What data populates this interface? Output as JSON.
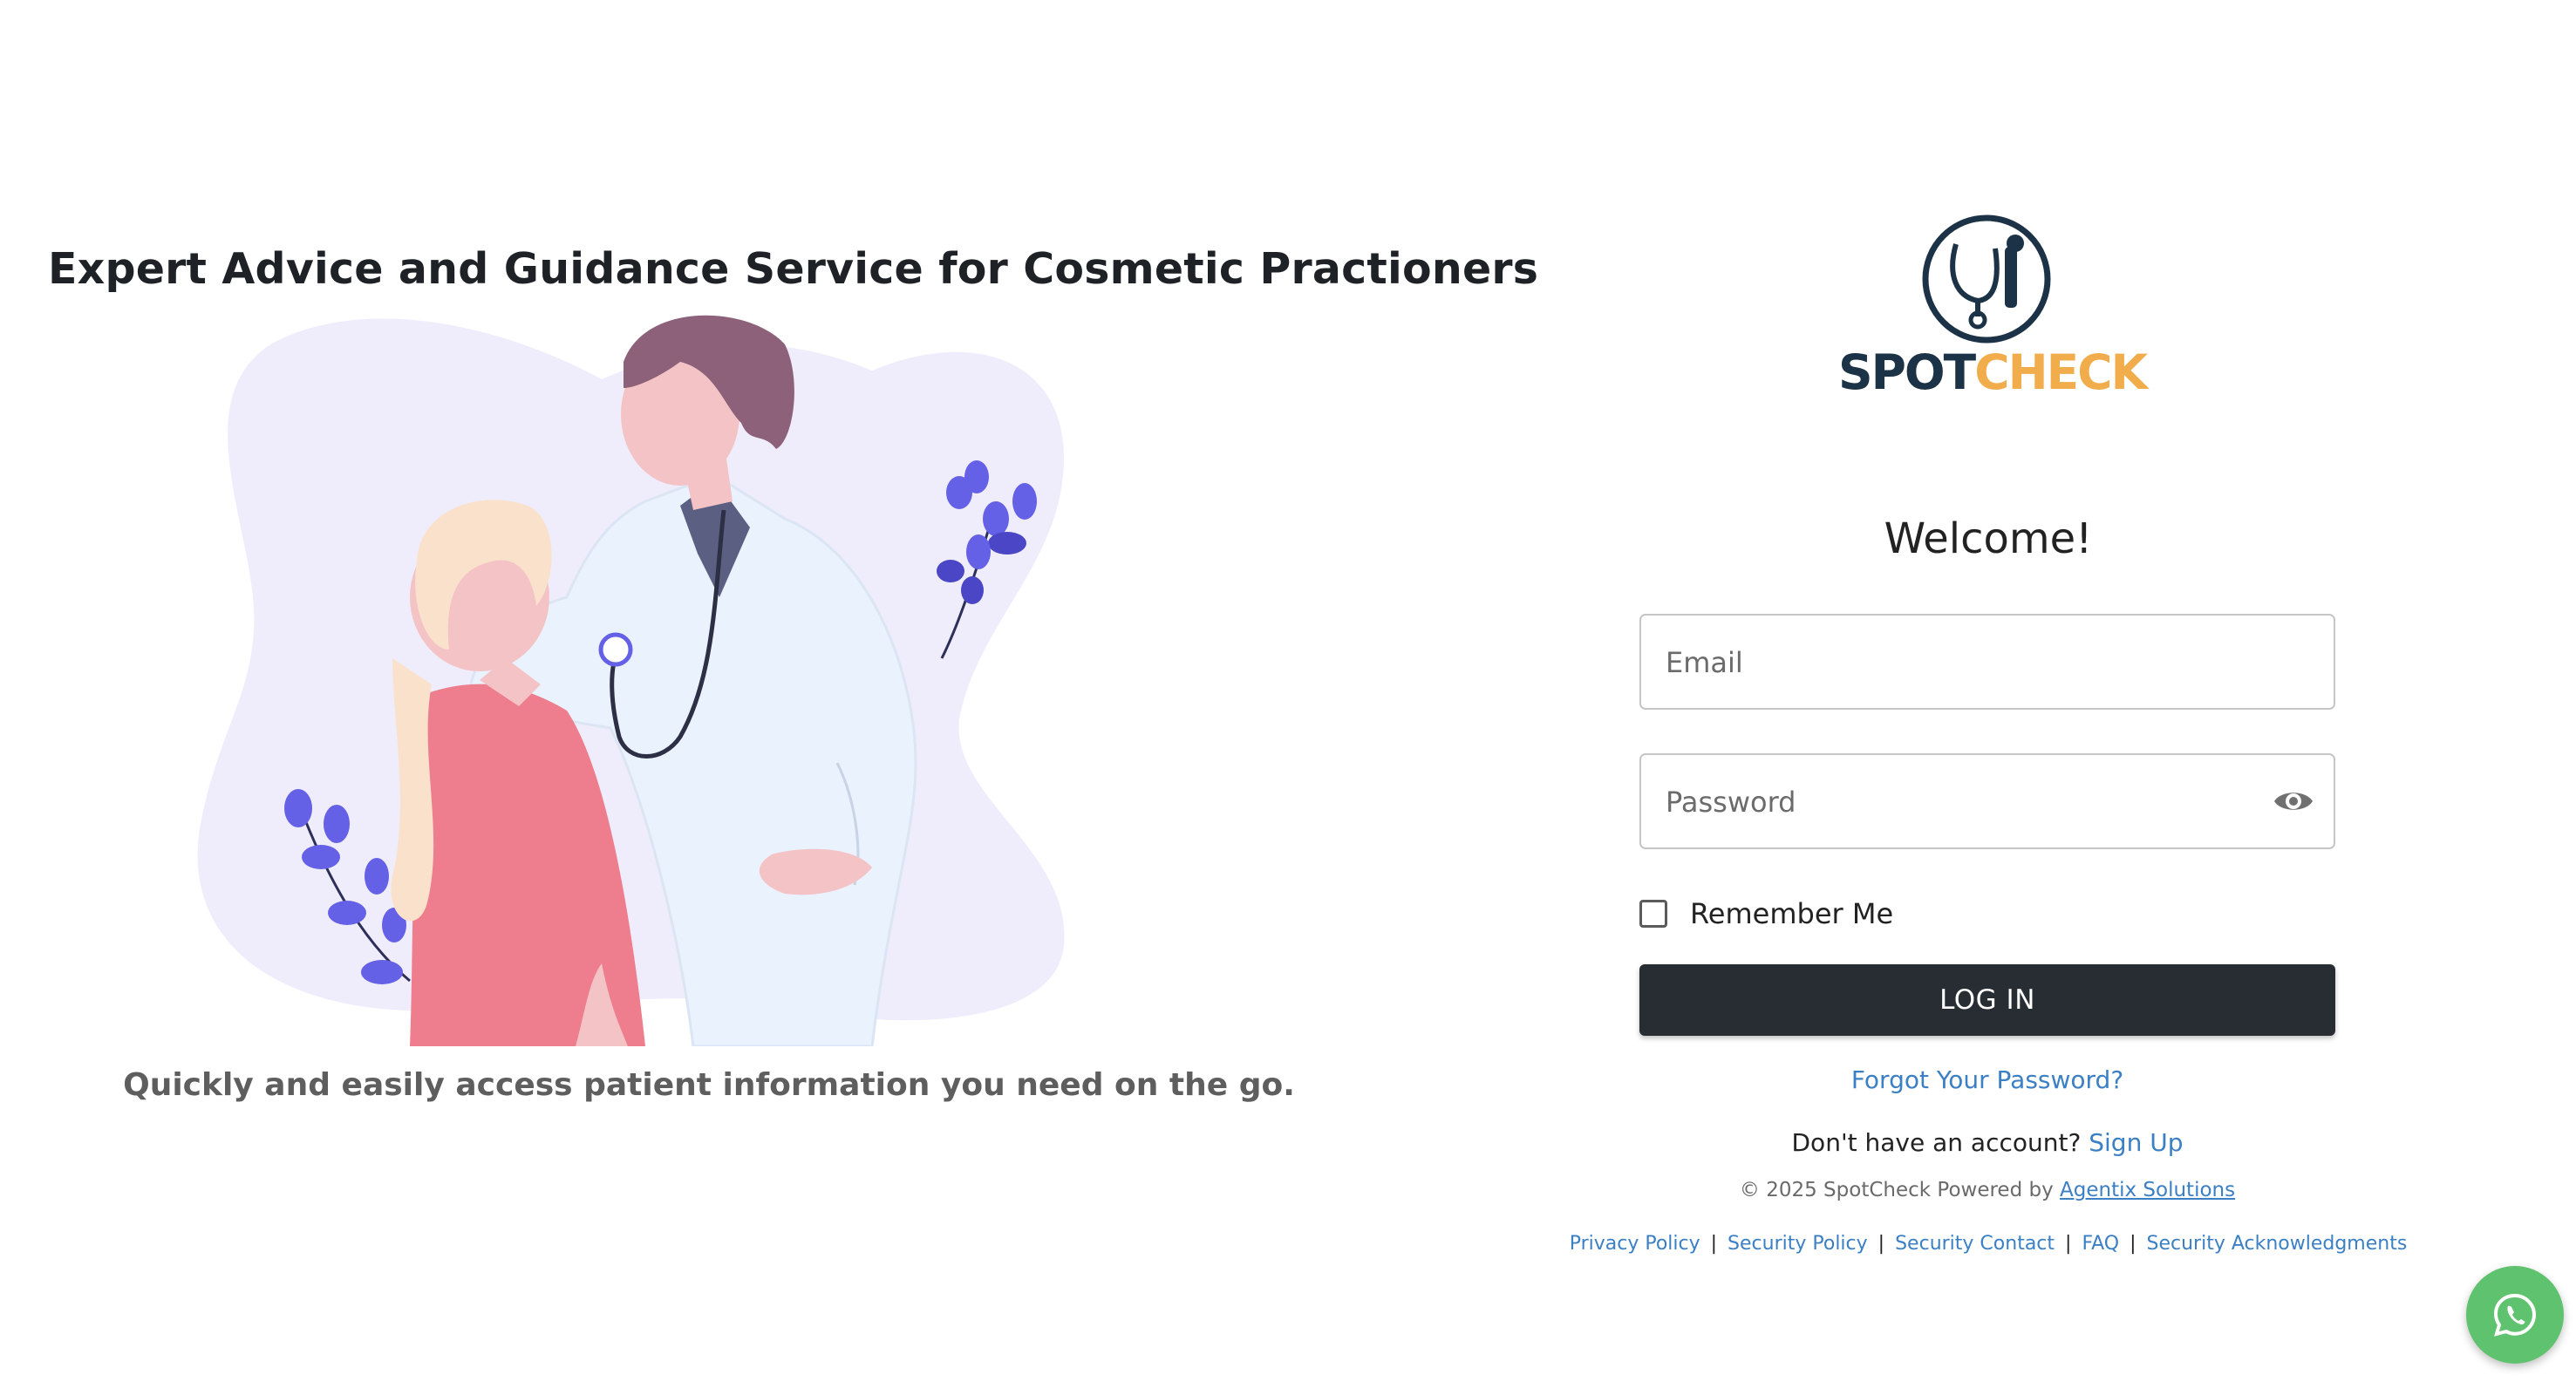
{
  "hero": {
    "title": "Expert Advice and Guidance Service for Cosmetic Practioners",
    "subtitle": "Quickly and easily access patient information you need on the go."
  },
  "brand": {
    "name_part1": "SPOT",
    "name_part2": "CHECK",
    "colors": {
      "navy": "#1c3347",
      "orange": "#f1ad4c"
    }
  },
  "login": {
    "welcome": "Welcome!",
    "email_placeholder": "Email",
    "password_placeholder": "Password",
    "remember_label": "Remember Me",
    "login_label": "LOG IN",
    "forgot_label": "Forgot Your Password?",
    "no_account_text": "Don't have an account?",
    "signup_label": "Sign Up"
  },
  "footer": {
    "copyright": "© 2025 SpotCheck Powered by",
    "powered_by_link": "Agentix Solutions",
    "links": [
      "Privacy Policy",
      "Security Policy",
      "Security Contact",
      "FAQ",
      "Security Acknowledgments"
    ]
  },
  "icons": {
    "password_toggle": "eye-icon",
    "chat": "whatsapp-icon"
  },
  "colors": {
    "primary_button": "#282c33",
    "link": "#3b7fc4",
    "chat_button": "#5fc26e"
  }
}
